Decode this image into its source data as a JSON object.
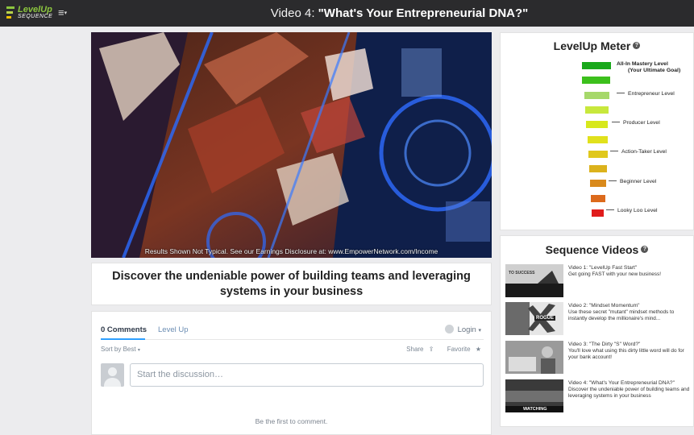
{
  "topbar": {
    "logo_line1": "LevelUp",
    "logo_line2": "SEQUENCE",
    "menu_icon": "hamburger-menu-icon",
    "title_prefix": "Video 4: ",
    "title_main": "\"What's Your Entrepreneurial DNA?\""
  },
  "video": {
    "caption": "Results Shown Not Typical. See our Earnings Disclosure at: www.EmpowerNetwork.com/Income"
  },
  "description": "Discover the undeniable power of building teams and leveraging systems in your business",
  "comments": {
    "tab_active": "0 Comments",
    "tab_other": "Level Up",
    "login": "Login",
    "login_caret": "▾",
    "sort": "Sort by Best",
    "sort_caret": "▾",
    "share": "Share",
    "share_icon": "⇪",
    "favorite": "Favorite",
    "favorite_icon": "★",
    "placeholder": "Start the discussion…",
    "empty_text": "Be the first to comment."
  },
  "meter": {
    "title": "LevelUp Meter",
    "help_icon": "?",
    "colors": [
      "#19a81b",
      "#3cc01c",
      "#a6d86a",
      "#c8e83c",
      "#d7e81c",
      "#e1e11c",
      "#e0c81c",
      "#dcb21c",
      "#d98a1c",
      "#dc6a1c",
      "#e01c1c"
    ],
    "levels": [
      {
        "label_line1": "All-In Mastery Level",
        "label_line2": "(Your Ultimate Goal)"
      },
      {
        "label": "Entrepreneur Level"
      },
      {
        "label": "Producer Level"
      },
      {
        "label": "Action-Taker Level"
      },
      {
        "label": "Beginner Level"
      },
      {
        "label": "Looky Loo Level"
      }
    ]
  },
  "sequence": {
    "title": "Sequence Videos",
    "help_icon": "?",
    "items": [
      {
        "title": "Video 1: \"LevelUp Fast Start\"",
        "desc": "Get going FAST with your new business!",
        "thumb_label": "TO SUCCESS"
      },
      {
        "title": "Video 2: \"Mindset Momentum\"",
        "desc": "Use these secret \"mutant\" mindset methods to instantly develop the millionaire's mind...",
        "thumb_label": "ROGUE"
      },
      {
        "title": "Video 3: \"The Dirty \"S\" Word?\"",
        "desc": "You'll love what using this dirty little word will do for your bank account!",
        "thumb_label": ""
      },
      {
        "title": "Video 4: \"What's Your Entrepreneurial DNA?\"",
        "desc": "Discover the undeniable power of building teams and leveraging systems in your business",
        "thumb_label": "WATCHING"
      }
    ]
  }
}
